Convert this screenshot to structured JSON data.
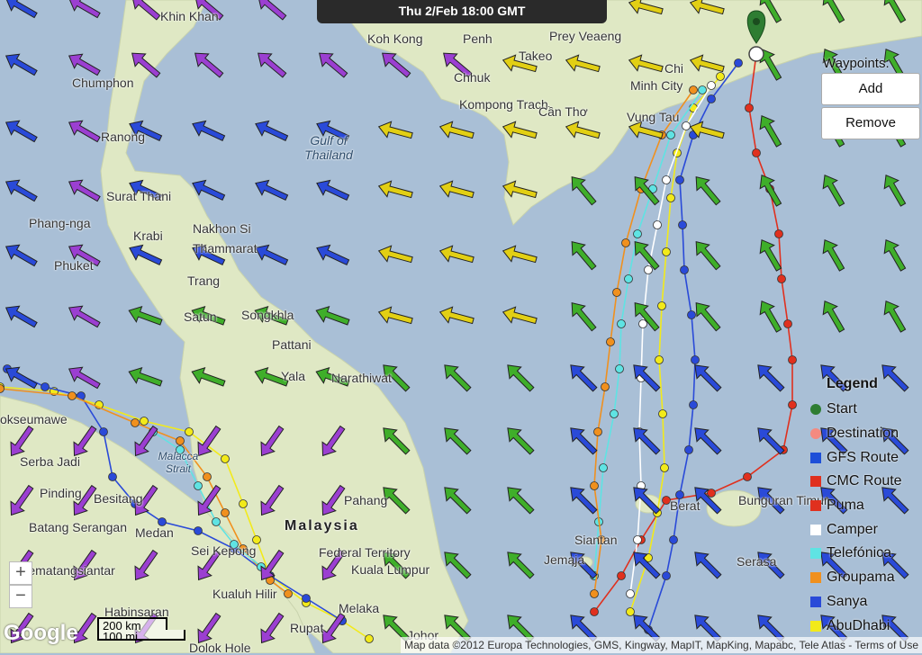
{
  "header": {
    "time_label": "Thu 2/Feb 18:00 GMT"
  },
  "place_labels": [
    {
      "id": "khin-khan",
      "text": "Khin Khan"
    },
    {
      "id": "chumphon",
      "text": "Chumphon"
    },
    {
      "id": "ranong",
      "text": "Ranong"
    },
    {
      "id": "surat-thani",
      "text": "Surat Thani"
    },
    {
      "id": "phang-nga",
      "text": "Phang-nga"
    },
    {
      "id": "krabi",
      "text": "Krabi"
    },
    {
      "id": "phuket",
      "text": "Phuket"
    },
    {
      "id": "nakhon-si",
      "text": "Nakhon Si"
    },
    {
      "id": "thammarat",
      "text": "Thammarat"
    },
    {
      "id": "trang",
      "text": "Trang"
    },
    {
      "id": "satun",
      "text": "Satun"
    },
    {
      "id": "songkhla",
      "text": "Songkhla"
    },
    {
      "id": "pattani",
      "text": "Pattani"
    },
    {
      "id": "yala",
      "text": "Yala"
    },
    {
      "id": "narathiwat",
      "text": "Narathiwat"
    },
    {
      "id": "gulf-of-thailand",
      "text": "Gulf of Thailand"
    },
    {
      "id": "koh-kong",
      "text": "Koh Kong"
    },
    {
      "id": "penh",
      "text": "Penh"
    },
    {
      "id": "prey-veaeng",
      "text": "Prey Veaeng"
    },
    {
      "id": "takeo",
      "text": "Takeo"
    },
    {
      "id": "chi",
      "text": "Chi"
    },
    {
      "id": "minh-city",
      "text": "Minh City"
    },
    {
      "id": "chhuk",
      "text": "Chhuk"
    },
    {
      "id": "kompong-trach",
      "text": "Kompong Trach"
    },
    {
      "id": "can-tho",
      "text": "Cần Thơ"
    },
    {
      "id": "vung-tau",
      "text": "Vung Tau"
    },
    {
      "id": "lhokseumawe",
      "text": "okseumawe"
    },
    {
      "id": "serba-jadi",
      "text": "Serba Jadi"
    },
    {
      "id": "pinding",
      "text": "Pinding"
    },
    {
      "id": "besitang",
      "text": "Besitang"
    },
    {
      "id": "batang-serangan",
      "text": "Batang Serangan"
    },
    {
      "id": "medan",
      "text": "Medan"
    },
    {
      "id": "malacca-strait",
      "text": "Malacca Strait"
    },
    {
      "id": "sei-kepong",
      "text": "Sei Kepong"
    },
    {
      "id": "pematangsiantar",
      "text": "Pematangsiantar"
    },
    {
      "id": "kualuh-hilir",
      "text": "Kualuh Hilir"
    },
    {
      "id": "habinsaran",
      "text": "Habinsaran"
    },
    {
      "id": "dolok-hole",
      "text": "Dolok Hole"
    },
    {
      "id": "rupat",
      "text": "Rupat"
    },
    {
      "id": "melaka",
      "text": "Melaka"
    },
    {
      "id": "johor",
      "text": "Johor"
    },
    {
      "id": "pahang",
      "text": "Pahang"
    },
    {
      "id": "malaysia",
      "text": "Malaysia"
    },
    {
      "id": "federal-territory",
      "text": "Federal Territory"
    },
    {
      "id": "kuala-lumpur",
      "text": "Kuala Lumpur"
    },
    {
      "id": "siantan",
      "text": "Siantan"
    },
    {
      "id": "jemaja",
      "text": "Jemaja"
    },
    {
      "id": "berat",
      "text": "Berat"
    },
    {
      "id": "bunguran-timur",
      "text": "Bunguran Timur"
    },
    {
      "id": "serasan",
      "text": "Serasa"
    }
  ],
  "waypoints": {
    "title": "Waypoints:",
    "add_label": "Add",
    "remove_label": "Remove"
  },
  "legend": {
    "title": "Legend",
    "items": [
      {
        "label": "Start",
        "color": "#2e7d32",
        "shape": "round"
      },
      {
        "label": "Destination",
        "color": "#f48a80",
        "shape": "round"
      },
      {
        "label": "GFS Route",
        "color": "#1e4fd8",
        "shape": "square"
      },
      {
        "label": "CMC Route",
        "color": "#e0301e",
        "shape": "square"
      },
      {
        "label": "Puma",
        "color": "#e0301e",
        "shape": "square"
      },
      {
        "label": "Camper",
        "color": "#ffffff",
        "shape": "square"
      },
      {
        "label": "Telefónica",
        "color": "#5fe3e3",
        "shape": "square"
      },
      {
        "label": "Groupama",
        "color": "#f0901e",
        "shape": "square"
      },
      {
        "label": "Sanya",
        "color": "#2a4ad8",
        "shape": "square"
      },
      {
        "label": "AbuDhabi",
        "color": "#f2ea1a",
        "shape": "square"
      }
    ]
  },
  "map_controls": {
    "zoom_in": "+",
    "zoom_out": "−"
  },
  "scale": {
    "km": "200 km",
    "mi": "100 mi"
  },
  "logo": "Google",
  "attribution": "Map data ©2012 Europa Technologies, GMS, Kingway, MapIT, MapKing, Mapabc, Tele Atlas - Terms of Use",
  "colors": {
    "sea": "#a9bfd6",
    "land": "#dfe8c4",
    "wind_purple": "#9b3fd1",
    "wind_blue": "#2a4ad8",
    "wind_green": "#3fae2a",
    "wind_yellow": "#e2cf14"
  }
}
